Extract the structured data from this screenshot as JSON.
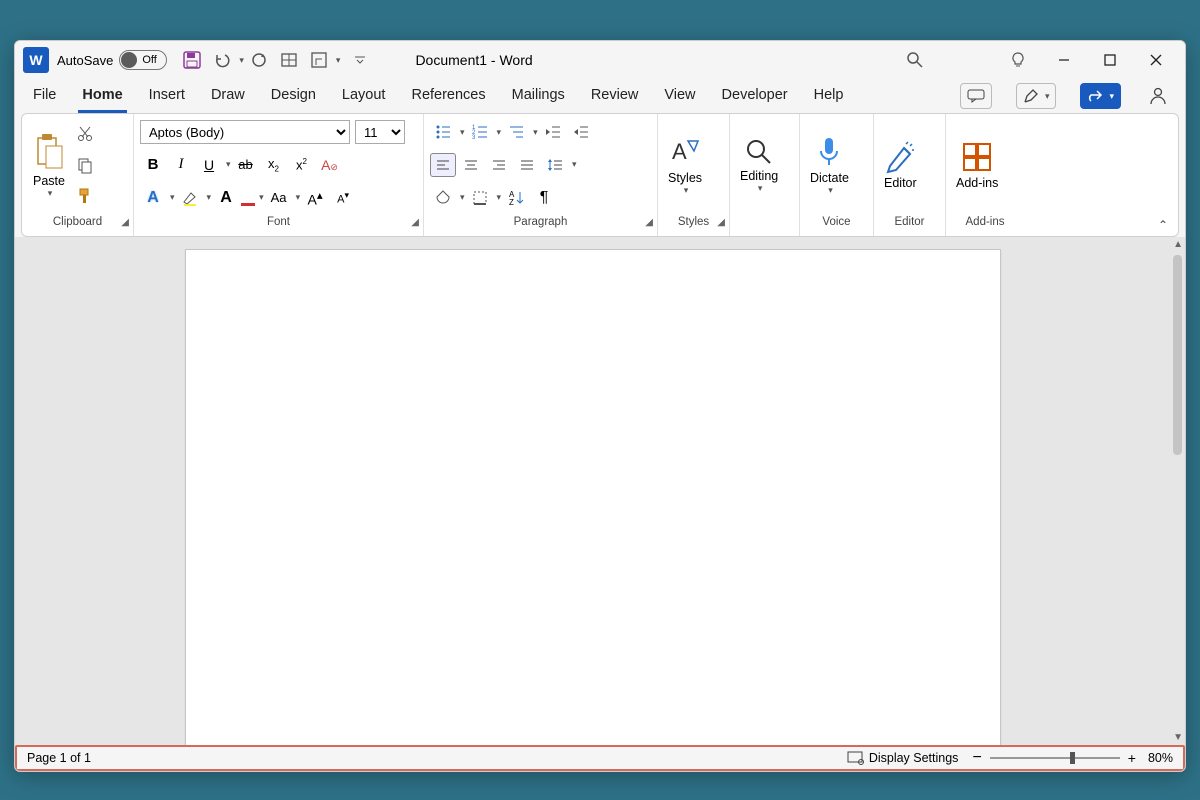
{
  "titlebar": {
    "autosave_label": "AutoSave",
    "autosave_state": "Off",
    "doc_title": "Document1  -  Word"
  },
  "tabs": {
    "items": [
      "File",
      "Home",
      "Insert",
      "Draw",
      "Design",
      "Layout",
      "References",
      "Mailings",
      "Review",
      "View",
      "Developer",
      "Help"
    ],
    "active": "Home"
  },
  "ribbon": {
    "clipboard": {
      "paste": "Paste",
      "label": "Clipboard"
    },
    "font": {
      "name": "Aptos (Body)",
      "size": "11",
      "label": "Font"
    },
    "paragraph": {
      "label": "Paragraph"
    },
    "styles": {
      "btn": "Styles",
      "label": "Styles"
    },
    "editing": {
      "btn": "Editing"
    },
    "dictate": {
      "btn": "Dictate",
      "label": "Voice"
    },
    "editor": {
      "btn": "Editor",
      "label": "Editor"
    },
    "addins": {
      "btn": "Add-ins",
      "label": "Add-ins"
    }
  },
  "status": {
    "page": "Page 1 of 1",
    "display": "Display Settings",
    "zoom": "80%"
  }
}
